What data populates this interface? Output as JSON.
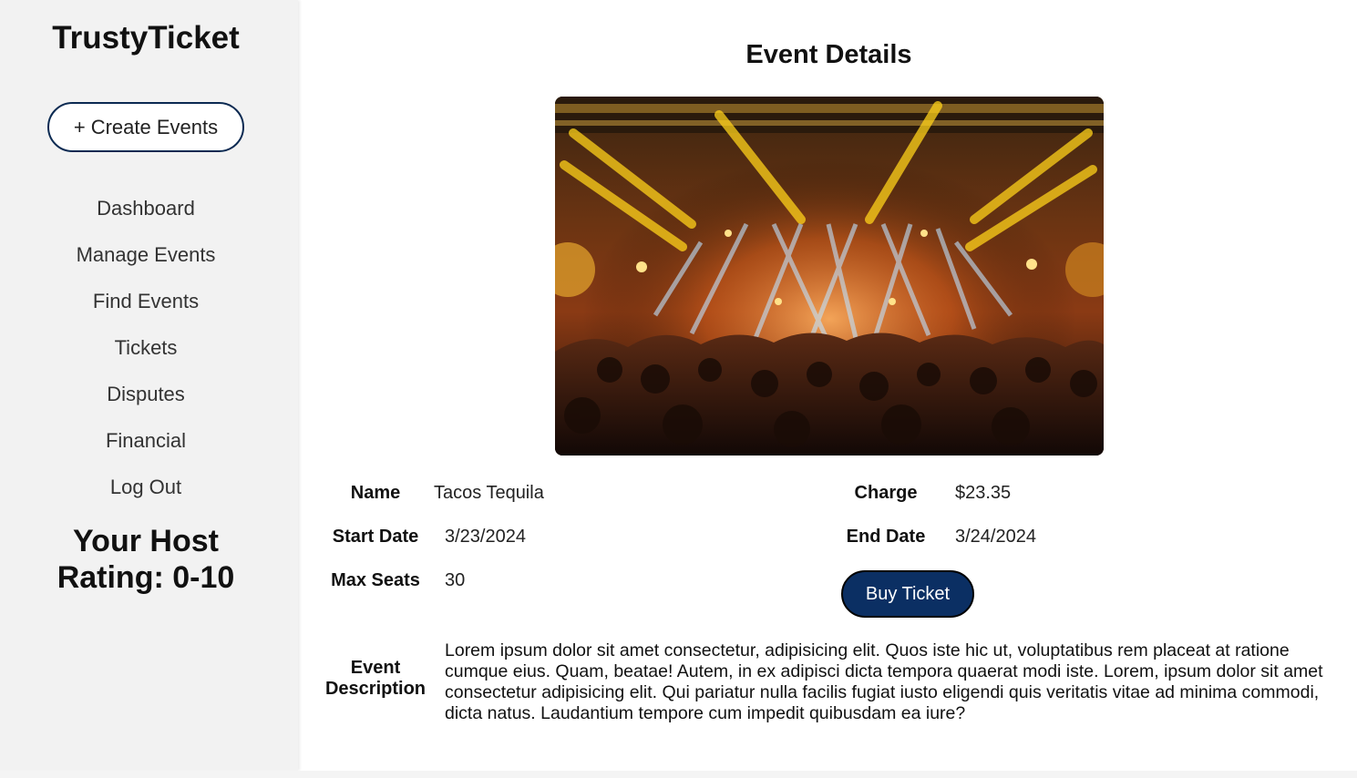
{
  "brand": "TrustyTicket",
  "sidebar": {
    "create_button": {
      "icon": "plus-icon",
      "symbol": "+",
      "label": "Create Events"
    },
    "nav_items": [
      {
        "label": "Dashboard"
      },
      {
        "label": "Manage Events"
      },
      {
        "label": "Find Events"
      },
      {
        "label": "Tickets"
      },
      {
        "label": "Disputes"
      },
      {
        "label": "Financial"
      },
      {
        "label": "Log Out"
      }
    ],
    "rating_line1": "Your Host",
    "rating_line2": "Rating: 0-10"
  },
  "main": {
    "title": "Event Details",
    "image": {
      "subject": "concert-stage-crowd-photo"
    },
    "fields": {
      "name_label": "Name",
      "name_value": "Tacos Tequila",
      "charge_label": "Charge",
      "charge_value": "$23.35",
      "start_label": "Start Date",
      "start_value": "3/23/2024",
      "end_label": "End Date",
      "end_value": "3/24/2024",
      "seats_label": "Max Seats",
      "seats_value": "30"
    },
    "buy_button": "Buy Ticket",
    "description_label_line1": "Event",
    "description_label_line2": "Description",
    "description": "Lorem ipsum dolor sit amet consectetur, adipisicing elit. Quos iste hic ut, voluptatibus rem placeat at ratione cumque eius. Quam, beatae! Autem, in ex adipisci dicta tempora quaerat modi iste. Lorem, ipsum dolor sit amet consectetur adipisicing elit. Qui pariatur nulla facilis fugiat iusto eligendi quis veritatis vitae ad minima commodi, dicta natus. Laudantium tempore cum impedit quibusdam ea iure?"
  },
  "colors": {
    "sidebar_bg": "#f2f2f2",
    "primary_navy": "#0b2f63",
    "button_text": "#ffffff"
  }
}
